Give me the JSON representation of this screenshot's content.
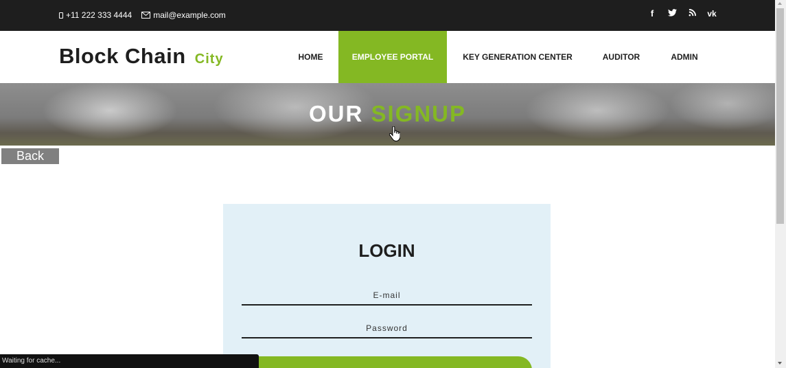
{
  "topbar": {
    "phone": "+11 222 333 4444",
    "email": "mail@example.com",
    "socials": [
      {
        "name": "facebook-icon",
        "glyph": "f"
      },
      {
        "name": "twitter-icon",
        "glyph": "🐦"
      },
      {
        "name": "rss-icon",
        "glyph": "ᵃ"
      },
      {
        "name": "vk-icon",
        "glyph": "vk"
      }
    ]
  },
  "brand": {
    "name": "Block Chain",
    "accent": "City"
  },
  "nav": {
    "home": "HOME",
    "employee_portal": "EMPLOYEE PORTAL",
    "key_generation_center": "KEY GENERATION CENTER",
    "auditor": "AUDITOR",
    "admin": "ADMIN",
    "active": "employee_portal"
  },
  "banner": {
    "title_main": "OUR",
    "title_accent": "SIGNUP"
  },
  "back_button": "Back",
  "login": {
    "title": "LOGIN",
    "email_placeholder": "E-mail",
    "password_placeholder": "Password"
  },
  "status_text": "Waiting for cache...",
  "colors": {
    "accent": "#84b823",
    "topbar": "#1e1e1e",
    "card": "#e2f0f7"
  }
}
